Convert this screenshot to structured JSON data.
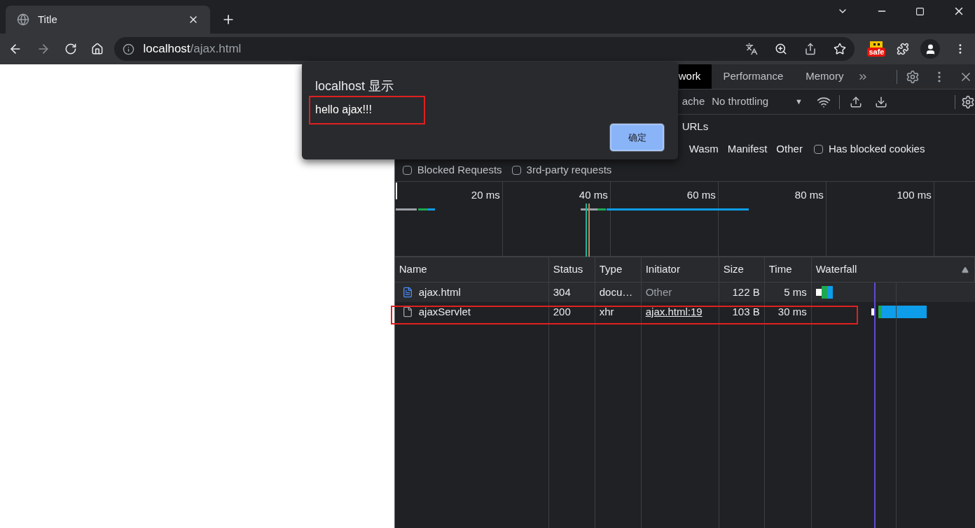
{
  "browser_tab": {
    "title": "Title",
    "selected": true
  },
  "address": {
    "host": "localhost",
    "path": "/ajax.html"
  },
  "extension_badge": "safe",
  "devtools": {
    "tabs": [
      {
        "label": "work",
        "selected": true
      },
      {
        "label": "Performance",
        "selected": false
      },
      {
        "label": "Memory",
        "selected": false
      }
    ],
    "cache_fragment": "ache",
    "throttling": "No throttling",
    "throttling_caret": "▼",
    "urls_label": "URLs",
    "type_filters": [
      "Wasm",
      "Manifest",
      "Other"
    ],
    "blocked_cookies": {
      "label": "Has blocked cookies",
      "checked": false
    },
    "request_filters": [
      {
        "label": "Blocked Requests",
        "checked": false
      },
      {
        "label": "3rd-party requests",
        "checked": false
      }
    ],
    "overview_ticks": [
      "20 ms",
      "40 ms",
      "60 ms",
      "80 ms",
      "100 ms"
    ],
    "columns": [
      "Name",
      "Status",
      "Type",
      "Initiator",
      "Size",
      "Time",
      "Waterfall"
    ],
    "rows": [
      {
        "kind": "document",
        "name": "ajax.html",
        "status": "304",
        "type": "docu…",
        "initiator": "Other",
        "initiator_link": false,
        "size": "122 B",
        "time": "5 ms"
      },
      {
        "kind": "xhr",
        "name": "ajaxServlet",
        "status": "200",
        "type": "xhr",
        "initiator": "ajax.html:19",
        "initiator_link": true,
        "size": "103 B",
        "time": "30 ms"
      }
    ]
  },
  "dialog": {
    "title": "localhost 显示",
    "message": "hello ajax!!!",
    "button": "确定"
  }
}
